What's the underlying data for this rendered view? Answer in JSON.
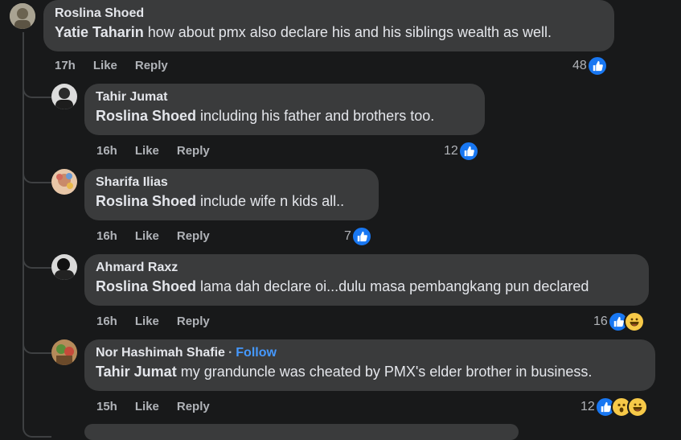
{
  "comments": [
    {
      "author": "Roslina Shoed",
      "mention": "Yatie Taharin",
      "text": "how about pmx also declare his and his siblings wealth as well.",
      "time": "17h",
      "like_label": "Like",
      "reply_label": "Reply",
      "reaction_count": "48",
      "reactions": [
        "like"
      ]
    },
    {
      "author": "Tahir Jumat",
      "mention": "Roslina Shoed",
      "text": "including his father and brothers too.",
      "time": "16h",
      "like_label": "Like",
      "reply_label": "Reply",
      "reaction_count": "12",
      "reactions": [
        "like"
      ]
    },
    {
      "author": "Sharifa Ilias",
      "mention": "Roslina Shoed",
      "text": "include wife n kids all..",
      "time": "16h",
      "like_label": "Like",
      "reply_label": "Reply",
      "reaction_count": "7",
      "reactions": [
        "like"
      ]
    },
    {
      "author": "Ahmard Raxz",
      "mention": "Roslina Shoed",
      "text": "lama dah declare oi...dulu masa pembangkang pun declared",
      "time": "16h",
      "like_label": "Like",
      "reply_label": "Reply",
      "reaction_count": "16",
      "reactions": [
        "like",
        "haha"
      ]
    },
    {
      "author": "Nor Hashimah Shafie",
      "follow_label": "Follow",
      "mention": "Tahir Jumat",
      "text": "my granduncle was cheated by PMX's elder brother in business.",
      "time": "15h",
      "like_label": "Like",
      "reply_label": "Reply",
      "reaction_count": "12",
      "reactions": [
        "like",
        "wow",
        "haha"
      ]
    }
  ],
  "colors": {
    "background": "#18191a",
    "bubble": "#3a3b3c",
    "like_blue": "#1877f2",
    "follow_blue": "#4599ff"
  }
}
